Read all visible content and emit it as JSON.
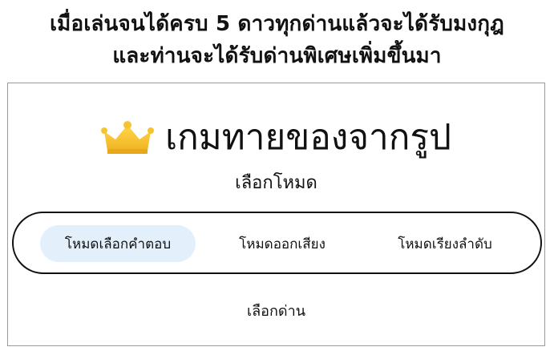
{
  "caption": {
    "line1": "เมื่อเล่นจนได้ครบ 5 ดาวทุกด่านแล้วจะได้รับมงกุฎ",
    "line2": "และท่านจะได้รับด่านพิเศษเพิ่มขึ้นมา"
  },
  "app": {
    "icon": "crown-icon",
    "title": "เกมทายของจากรูป",
    "mode_label": "เลือกโหมด",
    "modes": [
      {
        "label": "โหมดเลือกคำตอบ",
        "selected": true
      },
      {
        "label": "โหมดออกเสียง",
        "selected": false
      },
      {
        "label": "โหมดเรียงลำดับ",
        "selected": false
      }
    ],
    "select_level": "เลือกด่าน"
  },
  "colors": {
    "crown": "#f5c431",
    "selected_mode_bg": "#e3f0fb"
  }
}
